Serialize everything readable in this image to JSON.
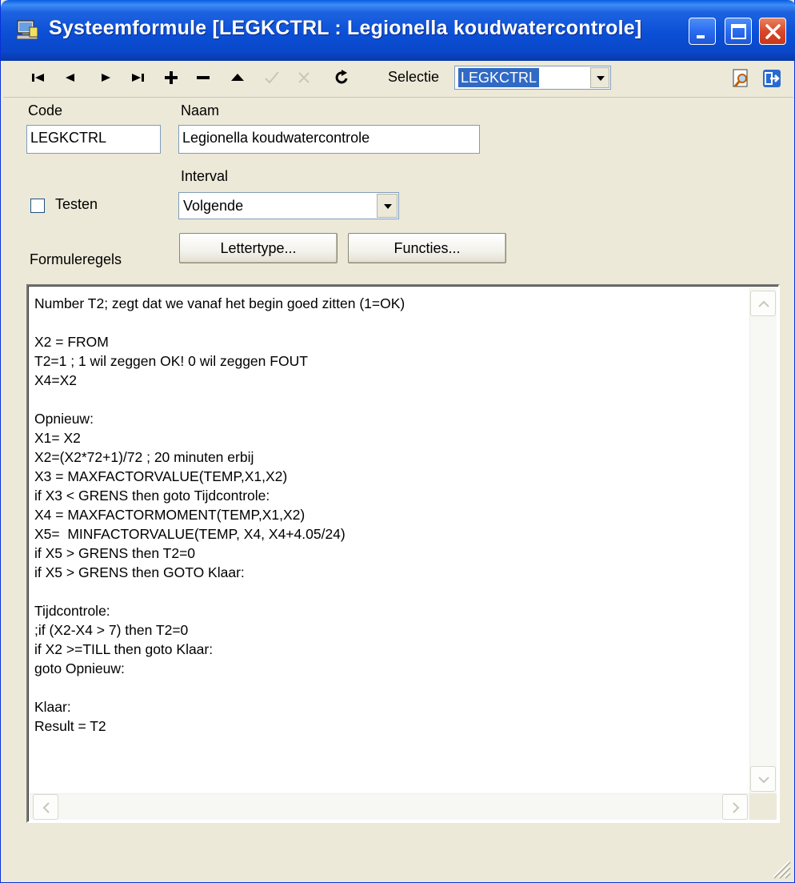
{
  "window": {
    "title": "Systeemformule [LEGKCTRL : Legionella koudwatercontrole]"
  },
  "toolbar": {
    "icons": [
      "first-record-icon",
      "previous-record-icon",
      "next-record-icon",
      "last-record-icon",
      "add-icon",
      "delete-icon",
      "up-icon",
      "confirm-icon",
      "cancel-icon",
      "refresh-icon",
      "preview-icon",
      "exit-icon"
    ],
    "selectie_label": "Selectie",
    "selectie_value": "LEGKCTRL"
  },
  "form": {
    "code_label": "Code",
    "code_value": "LEGKCTRL",
    "naam_label": "Naam",
    "naam_value": "Legionella koudwatercontrole",
    "interval_label": "Interval",
    "interval_value": "Volgende",
    "testen_label": "Testen",
    "testen_checked": false,
    "formuleregels_label": "Formuleregels",
    "lettertype_button": "Lettertype...",
    "functies_button": "Functies..."
  },
  "editor": {
    "lines": [
      "Number T2; zegt dat we vanaf het begin goed zitten (1=OK)",
      "",
      "X2 = FROM",
      "T2=1 ; 1 wil zeggen OK! 0 wil zeggen FOUT",
      "X4=X2",
      "",
      "Opnieuw:",
      "X1= X2",
      "X2=(X2*72+1)/72 ; 20 minuten erbij",
      "X3 = MAXFACTORVALUE(TEMP,X1,X2)",
      "if X3 < GRENS then goto Tijdcontrole:",
      "X4 = MAXFACTORMOMENT(TEMP,X1,X2)",
      "X5=  MINFACTORVALUE(TEMP, X4, X4+4.05/24)",
      "if X5 > GRENS then T2=0",
      "if X5 > GRENS then GOTO Klaar:",
      "",
      "Tijdcontrole:",
      ";if (X2-X4 > 7) then T2=0",
      "if X2 >=TILL then goto Klaar:",
      "goto Opnieuw:",
      "",
      "Klaar:",
      "Result = T2"
    ]
  },
  "colors": {
    "titlebar": "#0a47c9",
    "face": "#ece9d8",
    "selection": "#316ac5",
    "close_button": "#d9482a"
  }
}
